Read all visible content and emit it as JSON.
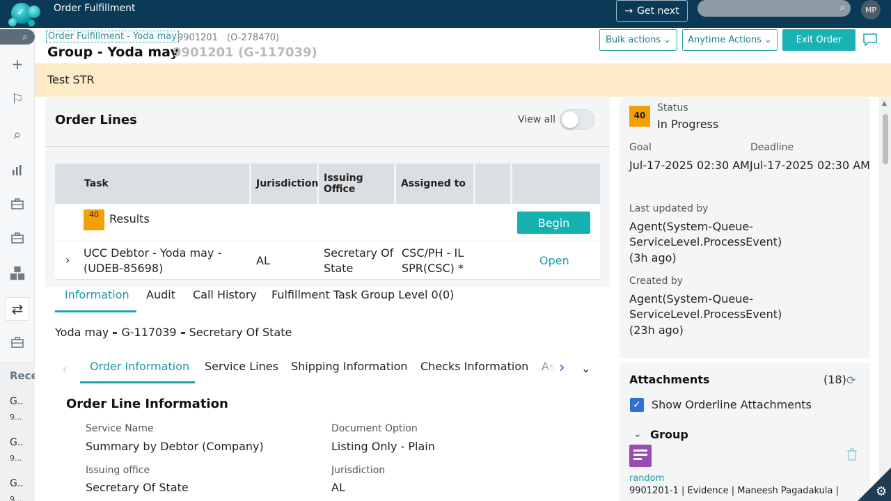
{
  "app": {
    "title": "Order Fulfillment",
    "get_next": "Get next",
    "user_initials": "MP"
  },
  "header": {
    "breadcrumb_link": "Order Fulfillment - Yoda may",
    "breadcrumb_id": "9901201",
    "breadcrumb_order": "(O-278470)",
    "title": "Group - Yoda may",
    "title_id": "9901201 (G-117039)",
    "bulk_actions": "Bulk actions",
    "anytime_actions": "Anytime Actions",
    "exit_order": "Exit Order"
  },
  "banner": {
    "text": "Test STR"
  },
  "order_lines": {
    "title": "Order Lines",
    "view_all": "View all",
    "columns": [
      "Task",
      "Jurisdiction",
      "Issuing Office",
      "Assigned to"
    ],
    "results_row": {
      "badge": "40",
      "label": "Results",
      "action": "Begin"
    },
    "task_row": {
      "task": "UCC Debtor - Yoda may - (UDEB-85698)",
      "jurisdiction": "AL",
      "issuing_office": "Secretary Of State",
      "assigned_to": "CSC/PH - IL SPR(CSC) *",
      "action": "Open"
    }
  },
  "detail_tabs": [
    "Information",
    "Audit",
    "Call History",
    "Fulfillment Task Group Level 0(0)"
  ],
  "summary": {
    "name": "Yoda may",
    "group": "G-117039",
    "office": "Secretary Of State"
  },
  "info_tabs": [
    "Order Information",
    "Service Lines",
    "Shipping Information",
    "Checks Information",
    "As"
  ],
  "order_line_info": {
    "title": "Order Line Information",
    "fields": [
      {
        "label": "Service Name",
        "value": "Summary by Debtor (Company)"
      },
      {
        "label": "Document Option",
        "value": "Listing Only - Plain"
      },
      {
        "label": "Issuing office",
        "value": "Secretary Of State"
      },
      {
        "label": "Jurisdiction",
        "value": "AL"
      }
    ]
  },
  "status_panel": {
    "badge": "40",
    "status_label": "Status",
    "status_value": "In Progress",
    "goal_label": "Goal",
    "goal_value": "Jul-17-2025 02:30 AM",
    "deadline_label": "Deadline",
    "deadline_value": "Jul-17-2025 02:30 AM",
    "updated_label": "Last updated by",
    "updated_line1": "Agent(System-Queue-",
    "updated_line2": "ServiceLevel.ProcessEvent)",
    "updated_ago": "(3h ago)",
    "created_label": "Created by",
    "created_line1": "Agent(System-Queue-",
    "created_line2": "ServiceLevel.ProcessEvent)",
    "created_ago": "(23h ago)"
  },
  "attachments": {
    "title": "Attachments",
    "count": "(18)",
    "show_orderline": "Show Orderline Attachments",
    "group_label": "Group",
    "item_name": "random",
    "item_meta": "9901201-1 | Evidence | Maneesh Pagadakula |"
  },
  "recent": {
    "heading": "Rece",
    "items": [
      {
        "title": "G..",
        "sub": "9..."
      },
      {
        "title": "G..",
        "sub": "9..."
      },
      {
        "title": "G..",
        "sub": "9..."
      }
    ]
  },
  "colors": {
    "topbar": "#0a3a56",
    "accent": "#19b2b4",
    "banner": "#fdebc7",
    "badge": "#f4a000"
  }
}
